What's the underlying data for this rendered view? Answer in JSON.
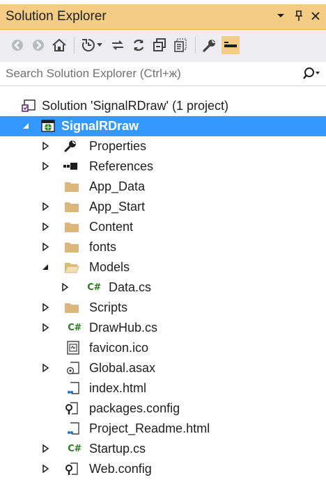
{
  "window": {
    "title": "Solution Explorer"
  },
  "search": {
    "placeholder": "Search Solution Explorer (Ctrl+ж)"
  },
  "tree": {
    "solution_label": "Solution 'SignalRDraw' (1 project)",
    "project_label": "SignalRDraw",
    "items": [
      {
        "label": "Properties"
      },
      {
        "label": "References"
      },
      {
        "label": "App_Data"
      },
      {
        "label": "App_Start"
      },
      {
        "label": "Content"
      },
      {
        "label": "fonts"
      },
      {
        "label": "Models"
      },
      {
        "label": "Data.cs"
      },
      {
        "label": "Scripts"
      },
      {
        "label": "DrawHub.cs"
      },
      {
        "label": "favicon.ico"
      },
      {
        "label": "Global.asax"
      },
      {
        "label": "index.html"
      },
      {
        "label": "packages.config"
      },
      {
        "label": "Project_Readme.html"
      },
      {
        "label": "Startup.cs"
      },
      {
        "label": "Web.config"
      }
    ]
  },
  "colors": {
    "title_bar": "#f5cc84",
    "selection": "#3399ff",
    "folder": "#dcb67a",
    "csharp_icon": "#2a7d1d"
  }
}
